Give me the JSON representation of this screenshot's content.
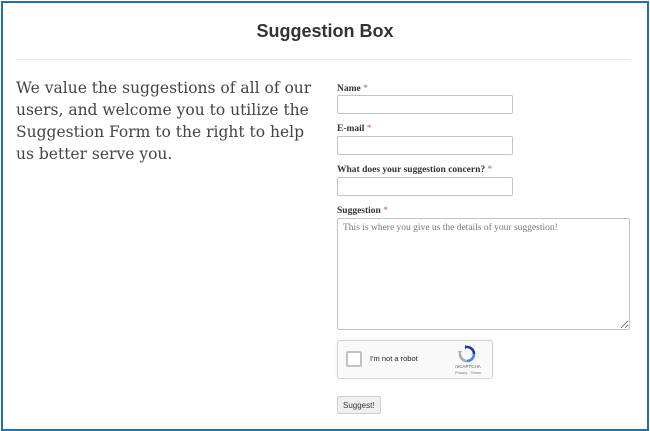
{
  "page": {
    "title": "Suggestion Box",
    "intro": "We value the suggestions of all of our users, and welcome you to utilize the Suggestion Form to the right to help us better serve you."
  },
  "form": {
    "required_marker": "*",
    "name_label": "Name",
    "email_label": "E-mail",
    "concern_label": "What does your suggestion concern?",
    "suggestion_label": "Suggestion",
    "name_value": "",
    "email_value": "",
    "concern_value": "",
    "suggestion_placeholder": "This is where you give us the details of your suggestion!",
    "submit_label": "Suggest!"
  },
  "captcha": {
    "checkbox_label": "I'm not a robot",
    "brand": "reCAPTCHA",
    "links": "Privacy - Terms",
    "icon": "recaptcha-logo-icon"
  },
  "colors": {
    "frame_border": "#1f6fb4",
    "required": "#d9534f"
  }
}
